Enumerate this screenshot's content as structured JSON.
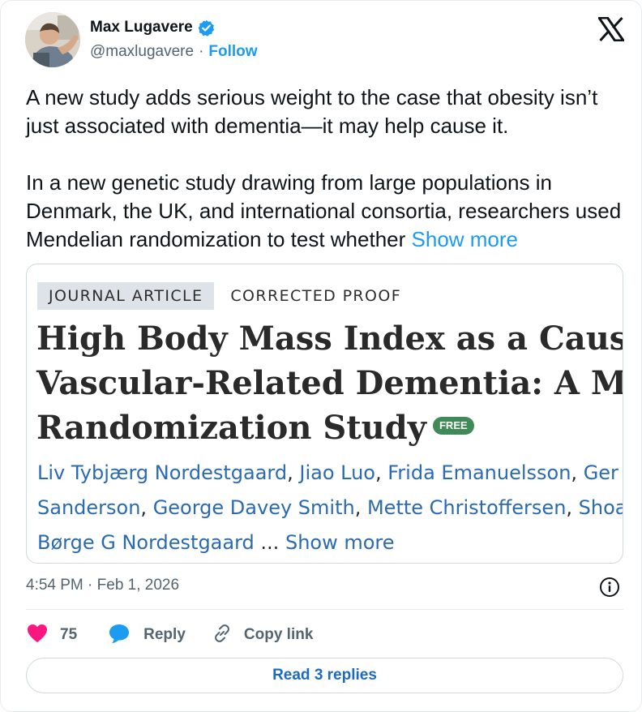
{
  "author": {
    "display_name": "Max Lugavere",
    "handle": "@maxlugavere",
    "separator": "·",
    "follow_label": "Follow",
    "verified_color": "#1d9bf0"
  },
  "tweet": {
    "paragraph_1": "A new study adds serious weight to the case that obesity isn’t just associated with dementia—it may help cause it.",
    "paragraph_2": "In a new genetic study drawing from large populations in Denmark, the UK, and international consortia, researchers used Mendelian randomization to test whether",
    "show_more_label": "Show more"
  },
  "article": {
    "tag_journal": "JOURNAL ARTICLE",
    "tag_status": "CORRECTED PROOF",
    "title_line_1": "High Body Mass Index as a Causal R",
    "title_line_2": "Vascular-Related Dementia: A Mend",
    "title_line_3": "Randomization Study",
    "free_badge": "FREE",
    "authors_line_1": [
      "Liv Tybjærg Nordestgaard",
      "Jiao Luo",
      "Frida Emanuelsson",
      "Ger"
    ],
    "authors_line_2": [
      "Sanderson",
      "George Davey Smith",
      "Mette Christoffersen",
      "Shoa"
    ],
    "authors_line_3": "Børge G Nordestgaard",
    "authors_ellipsis": "...",
    "authors_show_more": "Show more",
    "link_color": "#2a6ab3",
    "badge_color": "#3f8a56"
  },
  "meta": {
    "timestamp": "4:54 PM · Feb 1, 2026"
  },
  "actions": {
    "like_count": "75",
    "reply_label": "Reply",
    "copy_link_label": "Copy link",
    "like_color": "#f91880",
    "reply_color": "#1d9bf0"
  },
  "read_replies_label": "Read 3 replies",
  "icons": [
    "verified-badge-icon",
    "x-logo-icon",
    "info-icon",
    "heart-icon",
    "reply-bubble-icon",
    "link-icon"
  ]
}
